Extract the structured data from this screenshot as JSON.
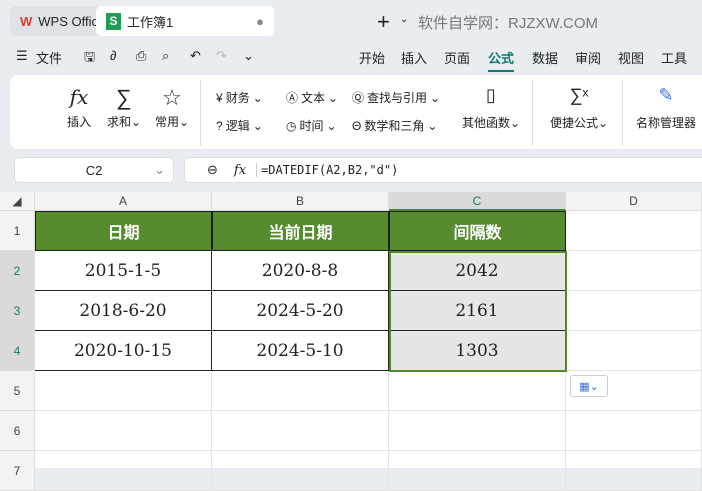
{
  "tabs": {
    "app": "WPS Office",
    "doc": "工作簿1",
    "watermark": "软件自学网：RJZXW.COM"
  },
  "menu": {
    "file": "文件",
    "items": [
      "开始",
      "插入",
      "页面",
      "公式",
      "数据",
      "审阅",
      "视图",
      "工具"
    ],
    "active": "公式"
  },
  "ribbon": {
    "insert": "插入",
    "sum": "求和",
    "common": "常用",
    "finance": "财务",
    "text": "文本",
    "lookup": "查找与引用",
    "logic": "逻辑",
    "time": "时间",
    "math": "数学和三角",
    "other": "其他函数",
    "quick": "便捷公式",
    "names": "名称管理器"
  },
  "formula_bar": {
    "cell_ref": "C2",
    "formula": "=DATEDIF(A2,B2,\"d\")"
  },
  "columns": [
    "A",
    "B",
    "C",
    "D"
  ],
  "rows": [
    "1",
    "2",
    "3",
    "4",
    "5",
    "6",
    "7"
  ],
  "table": {
    "headers": [
      "日期",
      "当前日期",
      "间隔数"
    ],
    "data": [
      [
        "2015-1-5",
        "2020-8-8",
        "2042"
      ],
      [
        "2018-6-20",
        "2024-5-20",
        "2161"
      ],
      [
        "2020-10-15",
        "2024-5-10",
        "1303"
      ]
    ]
  },
  "colors": {
    "header": "#568b2f",
    "active": "#0f7b6c"
  }
}
